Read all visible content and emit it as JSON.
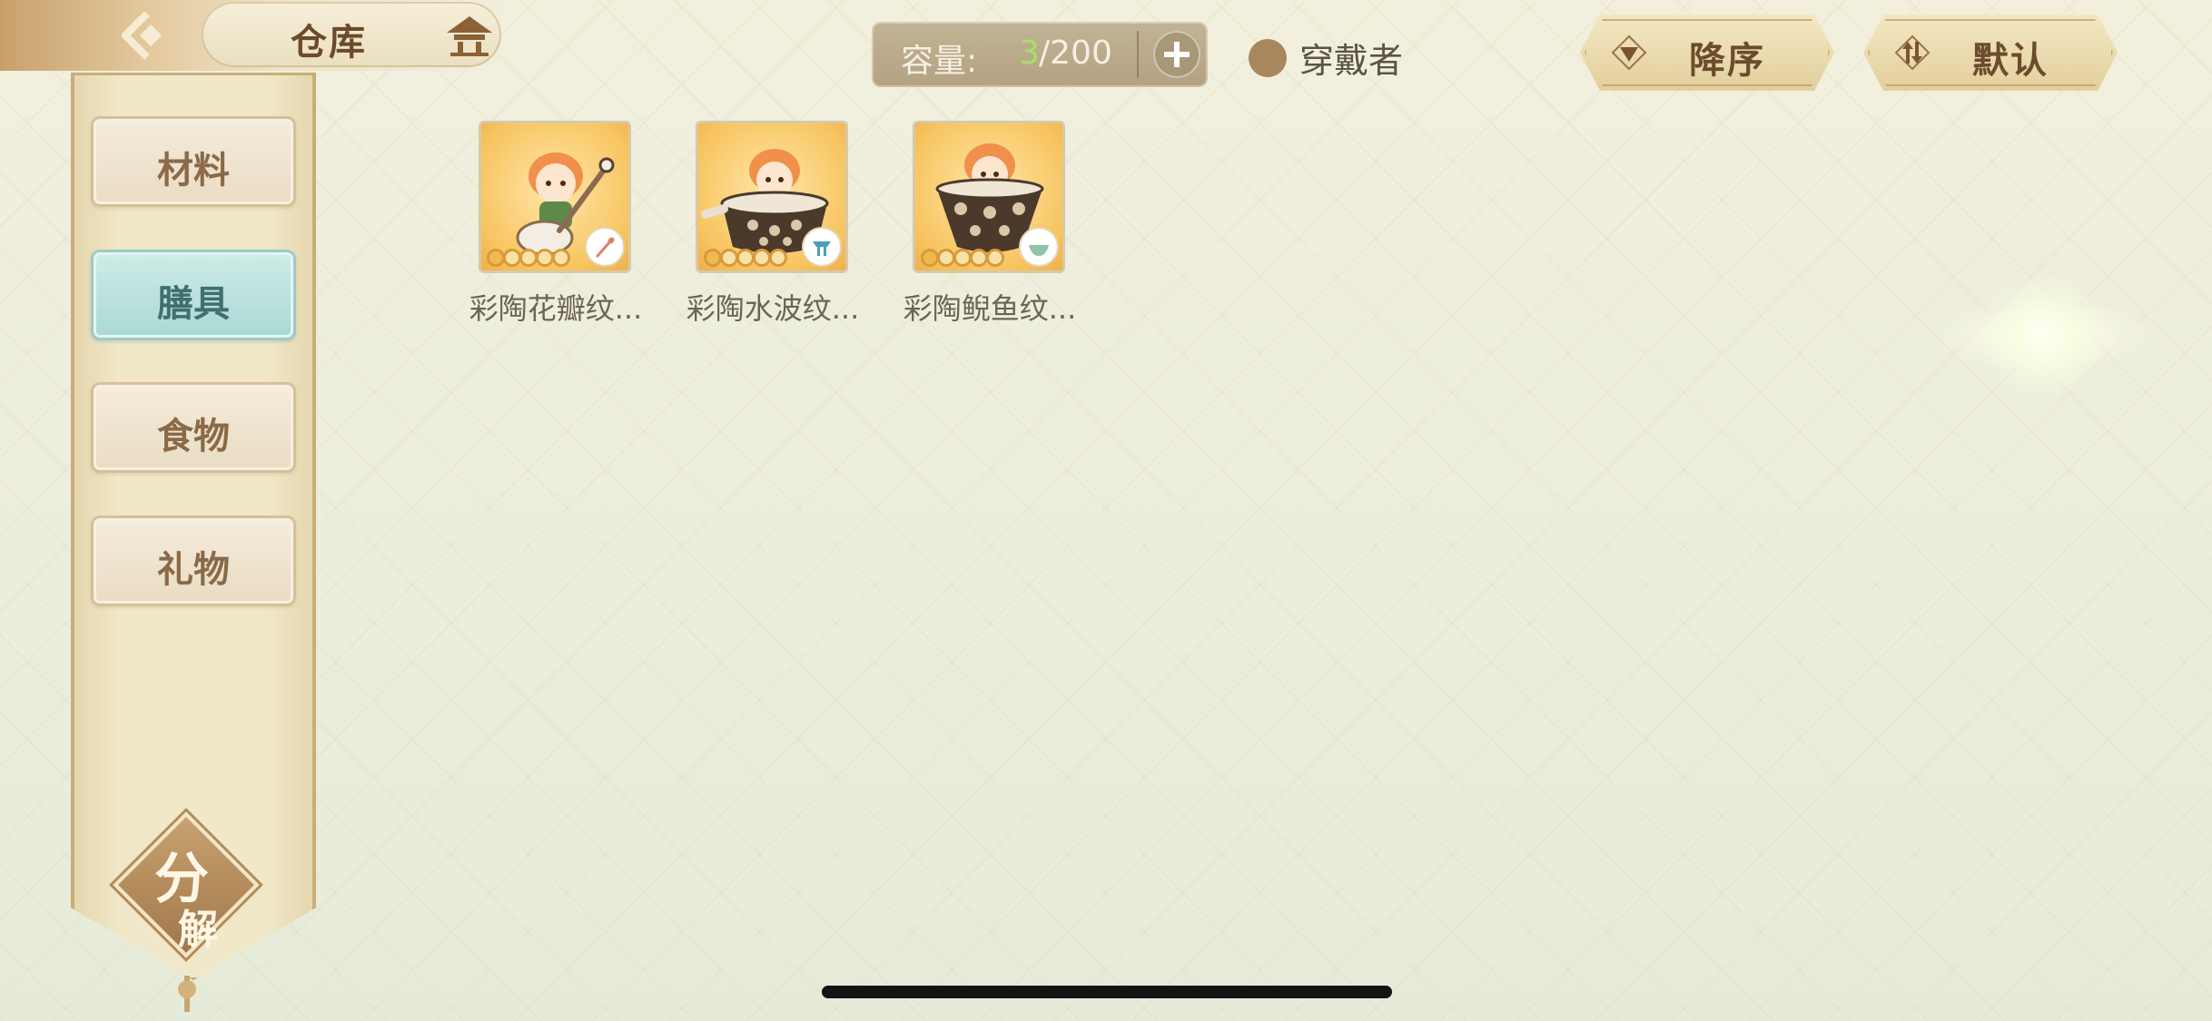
{
  "header": {
    "title": "仓库",
    "back_icon": "back-arrow-icon",
    "home_icon": "pavilion-icon"
  },
  "capacity": {
    "label": "容量:",
    "current": "3",
    "max": "/200",
    "current_color": "#a6e06a"
  },
  "wearer_toggle": {
    "label": "穿戴者"
  },
  "sort": {
    "order_label": "降序",
    "mode_label": "默认"
  },
  "sidebar": {
    "categories": [
      {
        "label": "材料",
        "active": false
      },
      {
        "label": "膳具",
        "active": true
      },
      {
        "label": "食物",
        "active": false
      },
      {
        "label": "礼物",
        "active": false
      }
    ],
    "decompose": {
      "char1": "分",
      "char2": "解"
    }
  },
  "items": [
    {
      "name": "彩陶花瓣纹...",
      "badge_icon": "spoon-icon",
      "stars": 5
    },
    {
      "name": "彩陶水波纹...",
      "badge_icon": "pot-icon",
      "stars": 5
    },
    {
      "name": "彩陶鲵鱼纹...",
      "badge_icon": "bowl-icon",
      "stars": 5
    }
  ],
  "colors": {
    "accent_gold": "#c9ad78",
    "active_tab": "#a9d8d5",
    "text_brown": "#6b4c2c"
  }
}
